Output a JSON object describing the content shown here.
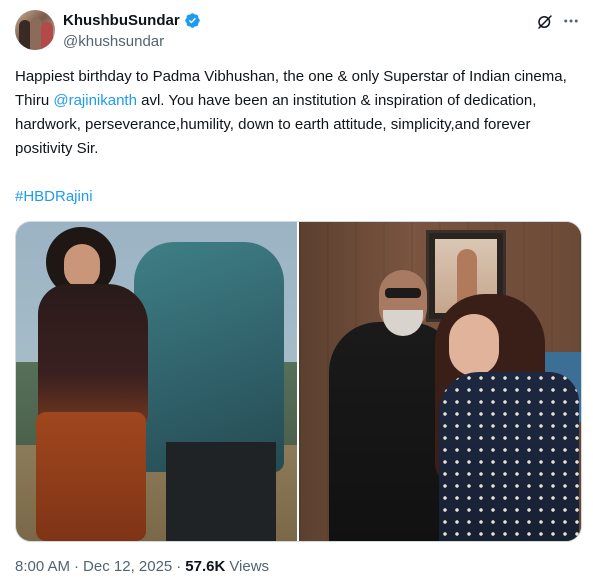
{
  "author": {
    "display_name": "KhushbuSundar",
    "handle": "@khushsundar",
    "verified": true,
    "avatar": "profile-avatar"
  },
  "header_actions": {
    "grok_icon": "grok-icon",
    "more_icon": "more-icon"
  },
  "tweet": {
    "text_before_mention": "Happiest birthday to Padma Vibhushan, the one & only Superstar of Indian cinema, Thiru ",
    "mention": "@rajinikanth",
    "text_after_mention": " avl. You have been an institution & inspiration of dedication, hardwork, perseverance,humility, down to earth attitude, simplicity,and forever positivity Sir.",
    "hashtag": "#HBDRajini"
  },
  "media": {
    "count": 2,
    "images": [
      "film-still-photo",
      "birthday-photo"
    ]
  },
  "footer": {
    "time": "8:00 AM",
    "separator": "·",
    "date": "Dec 12, 2025",
    "views_count": "57.6K",
    "views_label": "Views"
  },
  "colors": {
    "link": "#1d9bf0",
    "text": "#0f1419",
    "secondary": "#536471",
    "border": "#cfd9de"
  }
}
